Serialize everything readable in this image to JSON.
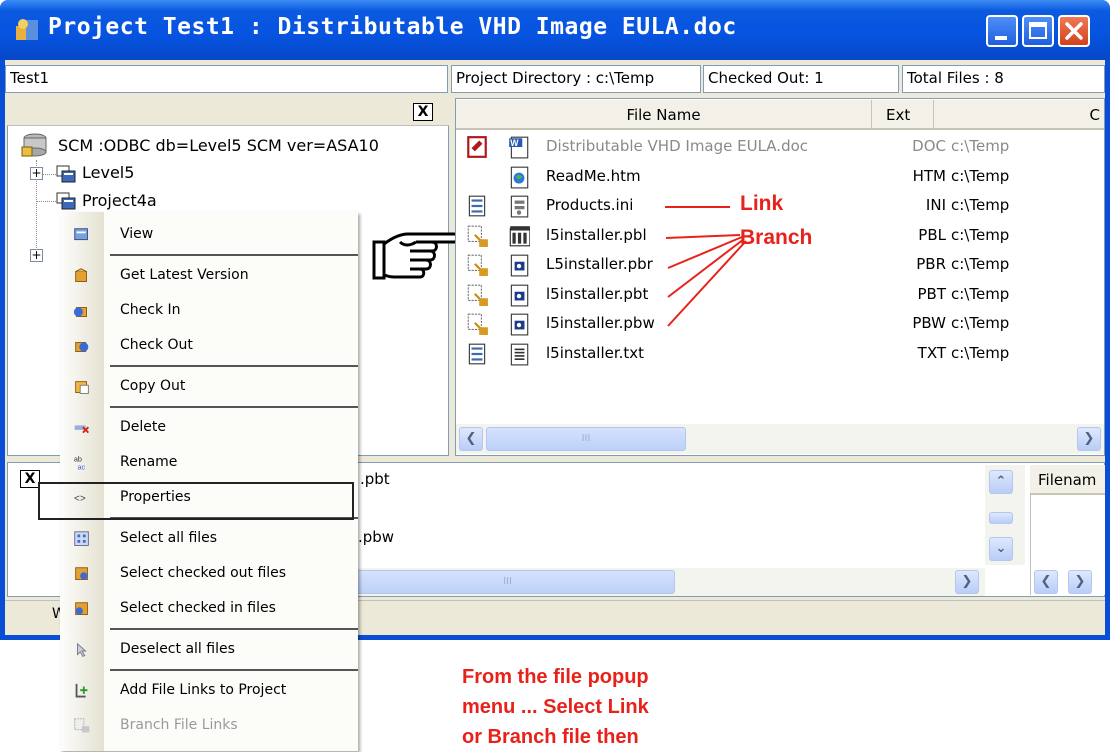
{
  "window": {
    "title": "Project  Test1 : Distributable VHD Image EULA.doc",
    "colors": {
      "titlebar": "#0653e0",
      "annotation": "#e8221b"
    }
  },
  "infobar": {
    "project_name": "Test1",
    "project_directory": "Project Directory : c:\\Temp",
    "checked_out": "Checked Out: 1",
    "total_files": "Total Files : 8"
  },
  "tree": {
    "close_label": "X",
    "root": "SCM :ODBC db=Level5 SCM ver=ASA10",
    "items": [
      {
        "label": "Level5",
        "expander": "+"
      },
      {
        "label": "Project4a",
        "expander": ""
      }
    ],
    "extra_expander": "+"
  },
  "files": {
    "columns": [
      "File Name",
      "Ext",
      "C"
    ],
    "rows": [
      {
        "name": "Distributable VHD Image EULA.doc",
        "ext": "DOC",
        "dir": "c:\\Temp",
        "status_icon": "checked-out-icon",
        "type_icon": "word-doc-icon",
        "dim": true
      },
      {
        "name": "ReadMe.htm",
        "ext": "HTM",
        "dir": "c:\\Temp",
        "status_icon": "",
        "type_icon": "html-file-icon",
        "dim": false
      },
      {
        "name": "Products.ini",
        "ext": "INI",
        "dir": "c:\\Temp",
        "status_icon": "link-file-icon",
        "type_icon": "ini-file-icon",
        "dim": false
      },
      {
        "name": "l5installer.pbl",
        "ext": "PBL",
        "dir": "c:\\Temp",
        "status_icon": "branch-file-icon",
        "type_icon": "pbl-library-icon",
        "dim": false
      },
      {
        "name": "L5installer.pbr",
        "ext": "PBR",
        "dir": "c:\\Temp",
        "status_icon": "branch-file-icon",
        "type_icon": "pb-object-icon",
        "dim": false
      },
      {
        "name": "l5installer.pbt",
        "ext": "PBT",
        "dir": "c:\\Temp",
        "status_icon": "branch-file-icon",
        "type_icon": "pb-object-icon",
        "dim": false
      },
      {
        "name": "l5installer.pbw",
        "ext": "PBW",
        "dir": "c:\\Temp",
        "status_icon": "branch-file-icon",
        "type_icon": "pb-object-icon",
        "dim": false
      },
      {
        "name": "l5installer.txt",
        "ext": "TXT",
        "dir": "c:\\Temp",
        "status_icon": "link-file-icon",
        "type_icon": "text-file-icon",
        "dim": false
      }
    ],
    "scroll_thumb": "III"
  },
  "bottom": {
    "close_label": "X",
    "row1_tail": ".pbt",
    "row2_tail": ".pbw",
    "side_header": "Filenam",
    "scroll_thumb": "III",
    "status_left": "W"
  },
  "context_menu": {
    "items": [
      {
        "label": "View",
        "icon": "view-icon",
        "enabled": true,
        "sep_after": true
      },
      {
        "label": "Get Latest Version",
        "icon": "get-latest-icon",
        "enabled": true,
        "sep_after": false
      },
      {
        "label": "Check In",
        "icon": "check-in-icon",
        "enabled": true,
        "sep_after": false
      },
      {
        "label": "Check Out",
        "icon": "check-out-icon",
        "enabled": true,
        "sep_after": true
      },
      {
        "label": "Copy Out",
        "icon": "copy-out-icon",
        "enabled": true,
        "sep_after": true
      },
      {
        "label": "Delete",
        "icon": "delete-icon",
        "enabled": true,
        "sep_after": false
      },
      {
        "label": "Rename",
        "icon": "rename-icon",
        "enabled": true,
        "sep_after": false
      },
      {
        "label": "Properties",
        "icon": "properties-icon",
        "enabled": true,
        "sep_after": true
      },
      {
        "label": "Select all files",
        "icon": "select-all-icon",
        "enabled": true,
        "sep_after": false
      },
      {
        "label": "Select checked out files",
        "icon": "select-checked-out-icon",
        "enabled": true,
        "sep_after": false
      },
      {
        "label": "Select checked in files",
        "icon": "select-checked-in-icon",
        "enabled": true,
        "sep_after": true
      },
      {
        "label": "Deselect all files",
        "icon": "deselect-icon",
        "enabled": true,
        "sep_after": true
      },
      {
        "label": "Add File Links to Project",
        "icon": "add-links-icon",
        "enabled": true,
        "sep_after": false
      },
      {
        "label": "Branch File Links",
        "icon": "branch-links-icon",
        "enabled": false,
        "sep_after": false
      }
    ]
  },
  "annotations": {
    "link": "Link",
    "branch": "Branch",
    "caption_lines": [
      "From the file popup",
      "menu ... Select Link",
      "or Branch file then"
    ],
    "pointer_icon": "pointing-hand-icon"
  }
}
